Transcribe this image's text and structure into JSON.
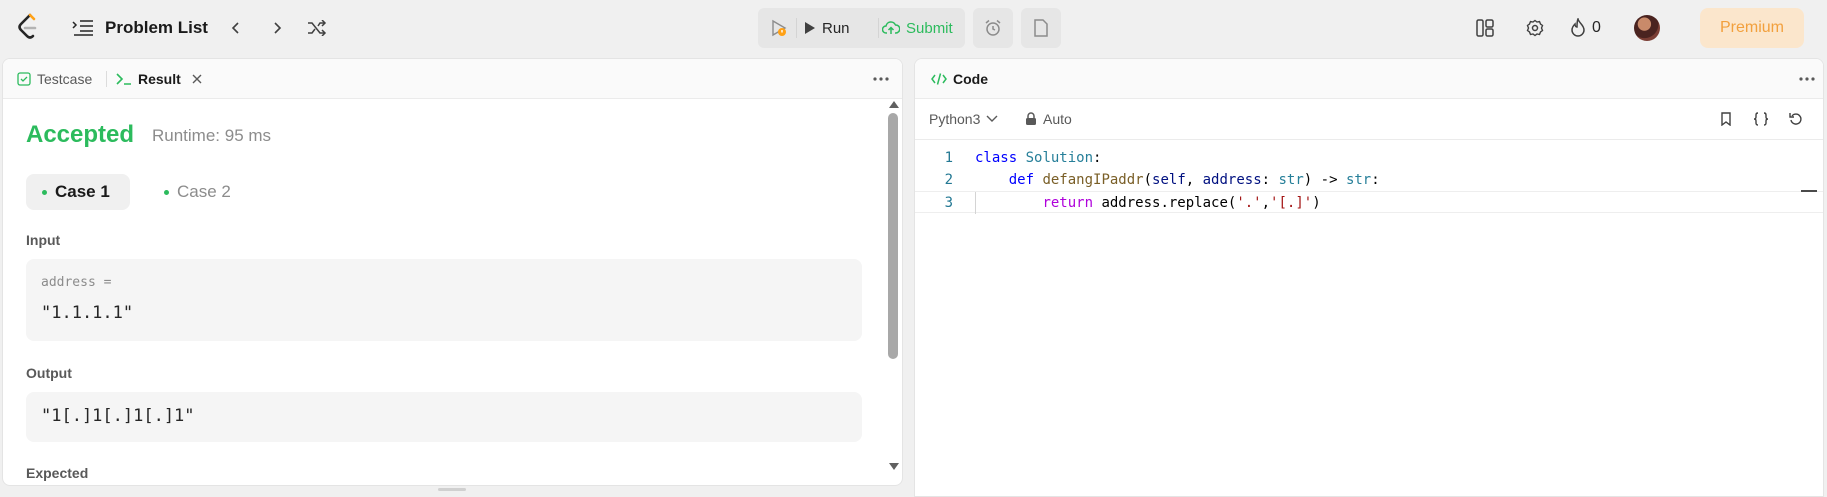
{
  "topbar": {
    "problem_list_label": "Problem List",
    "run_label": "Run",
    "submit_label": "Submit",
    "streak_count": "0",
    "premium_label": "Premium"
  },
  "result_panel": {
    "tabs": [
      {
        "label": "Testcase",
        "active": false
      },
      {
        "label": "Result",
        "active": true
      }
    ],
    "status": "Accepted",
    "runtime": "Runtime: 95 ms",
    "cases": [
      {
        "label": "Case 1",
        "active": true
      },
      {
        "label": "Case 2",
        "active": false
      }
    ],
    "input_label": "Input",
    "input_var": "address =",
    "input_value": "\"1.1.1.1\"",
    "output_label": "Output",
    "output_value": "\"1[.]1[.]1[.]1\"",
    "expected_label": "Expected"
  },
  "code_panel": {
    "title": "Code",
    "language": "Python3",
    "mode": "Auto",
    "lines": [
      {
        "num": "1",
        "text": "class Solution:"
      },
      {
        "num": "2",
        "text": "    def defangIPaddr(self, address: str) -> str:"
      },
      {
        "num": "3",
        "text": "        return address.replace('.','[.]')"
      }
    ]
  },
  "colors": {
    "accepted": "#2cbb5d",
    "submit": "#2cbb5d",
    "premium_bg": "#fbe6cc",
    "premium_text": "#f2a03d"
  }
}
